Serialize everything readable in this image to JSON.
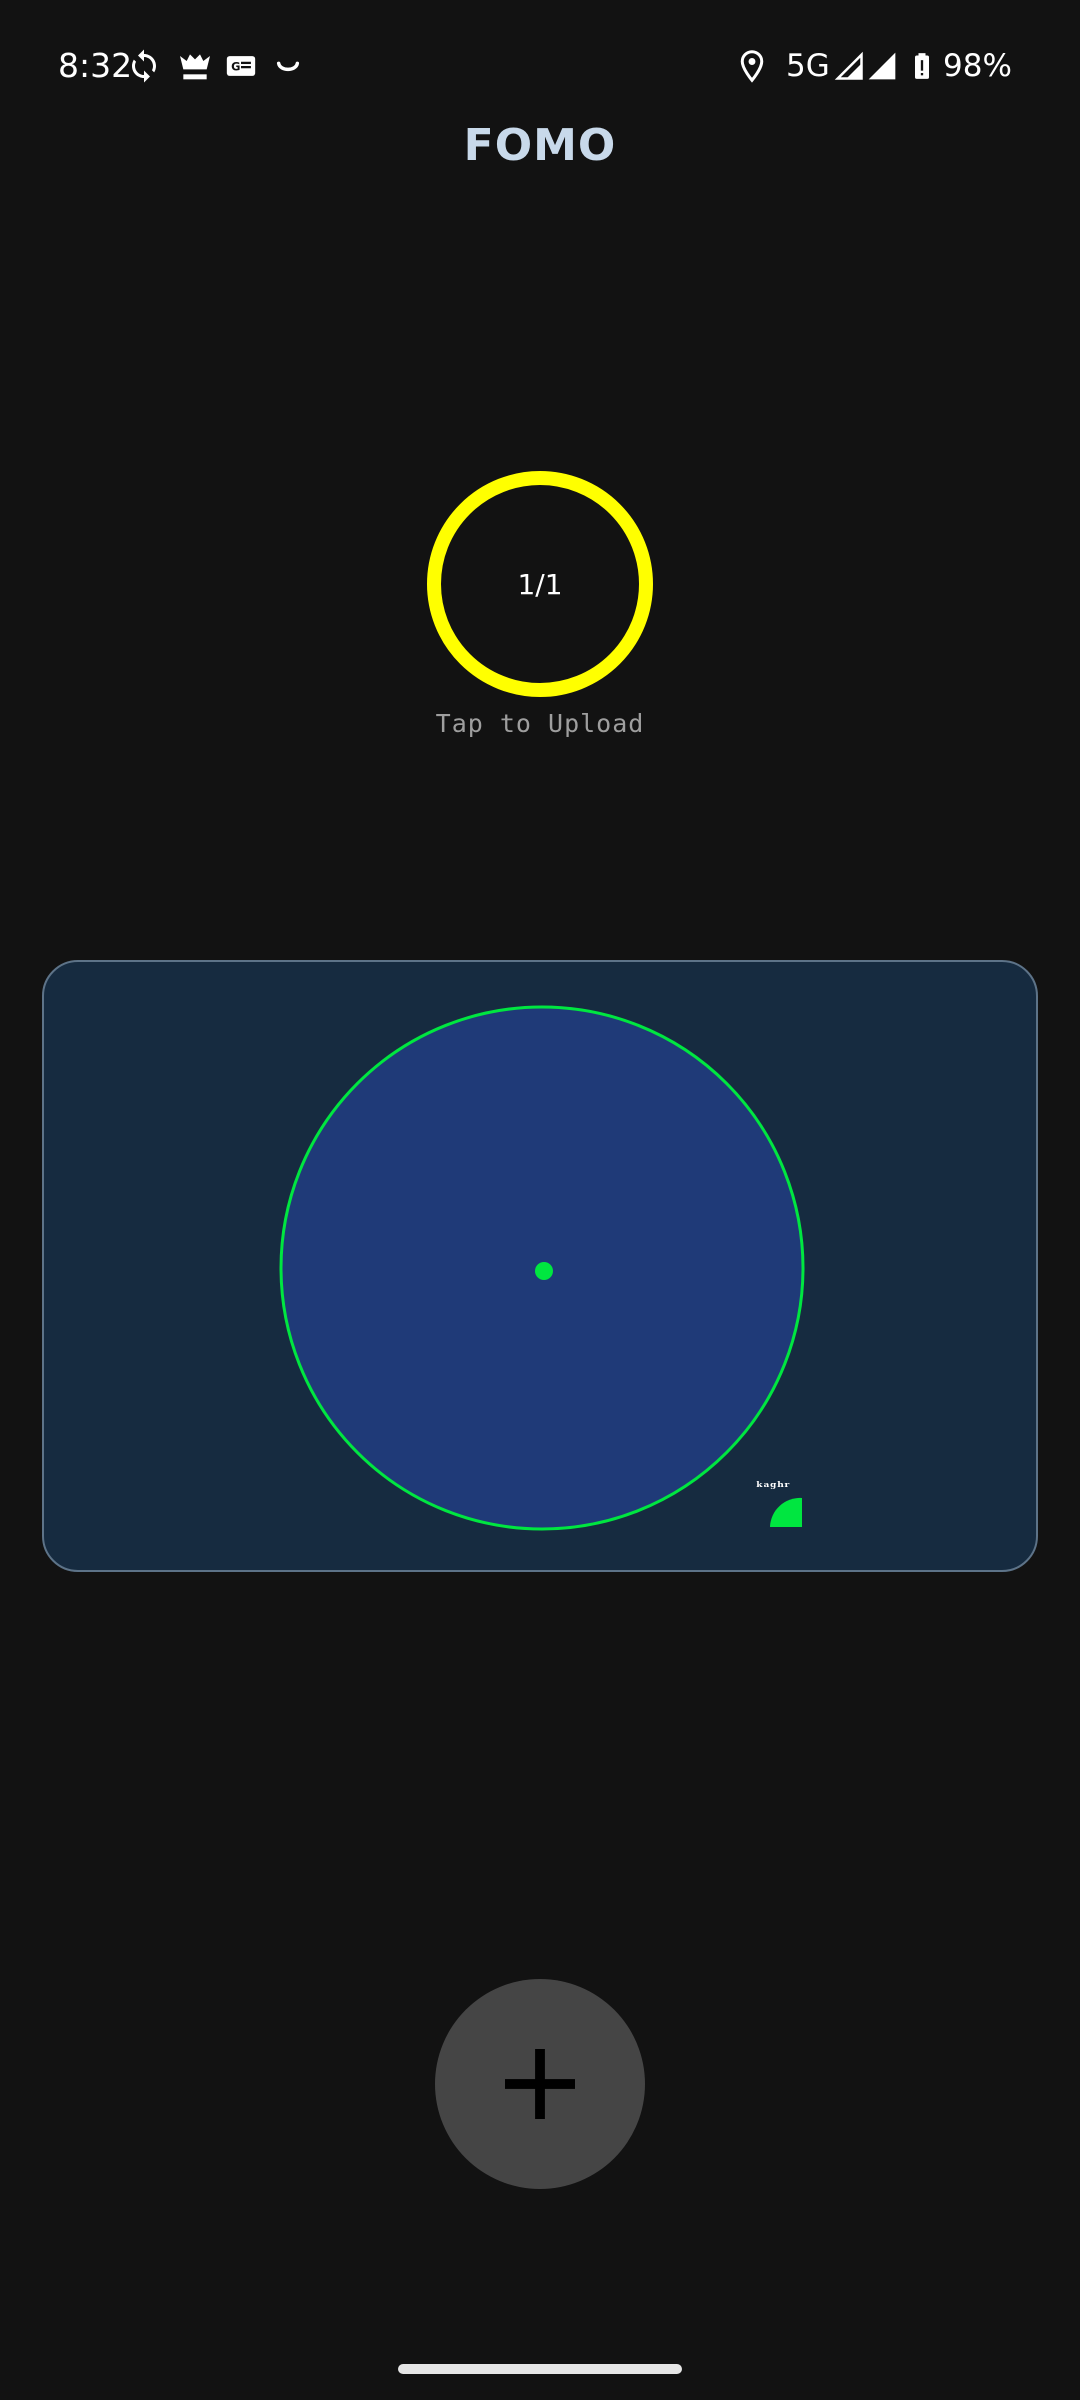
{
  "status_bar": {
    "time": "8:32",
    "network": "5G",
    "battery": "98%",
    "icons": [
      "sync-icon",
      "fool-app-icon",
      "news-icon",
      "smile-icon",
      "location-icon",
      "signal-icon",
      "signal-icon",
      "battery-alert-icon"
    ]
  },
  "app": {
    "title": "FOMO"
  },
  "upload": {
    "count": "1/1",
    "hint": "Tap to Upload",
    "ring_color": "#ffff00"
  },
  "map": {
    "background": "#162b40",
    "circle_fill": "#1f3a78",
    "accent_color": "#00e640",
    "corner_label": "ᵏᵃᵍʰʳ"
  },
  "fab": {
    "icon": "plus-icon"
  }
}
